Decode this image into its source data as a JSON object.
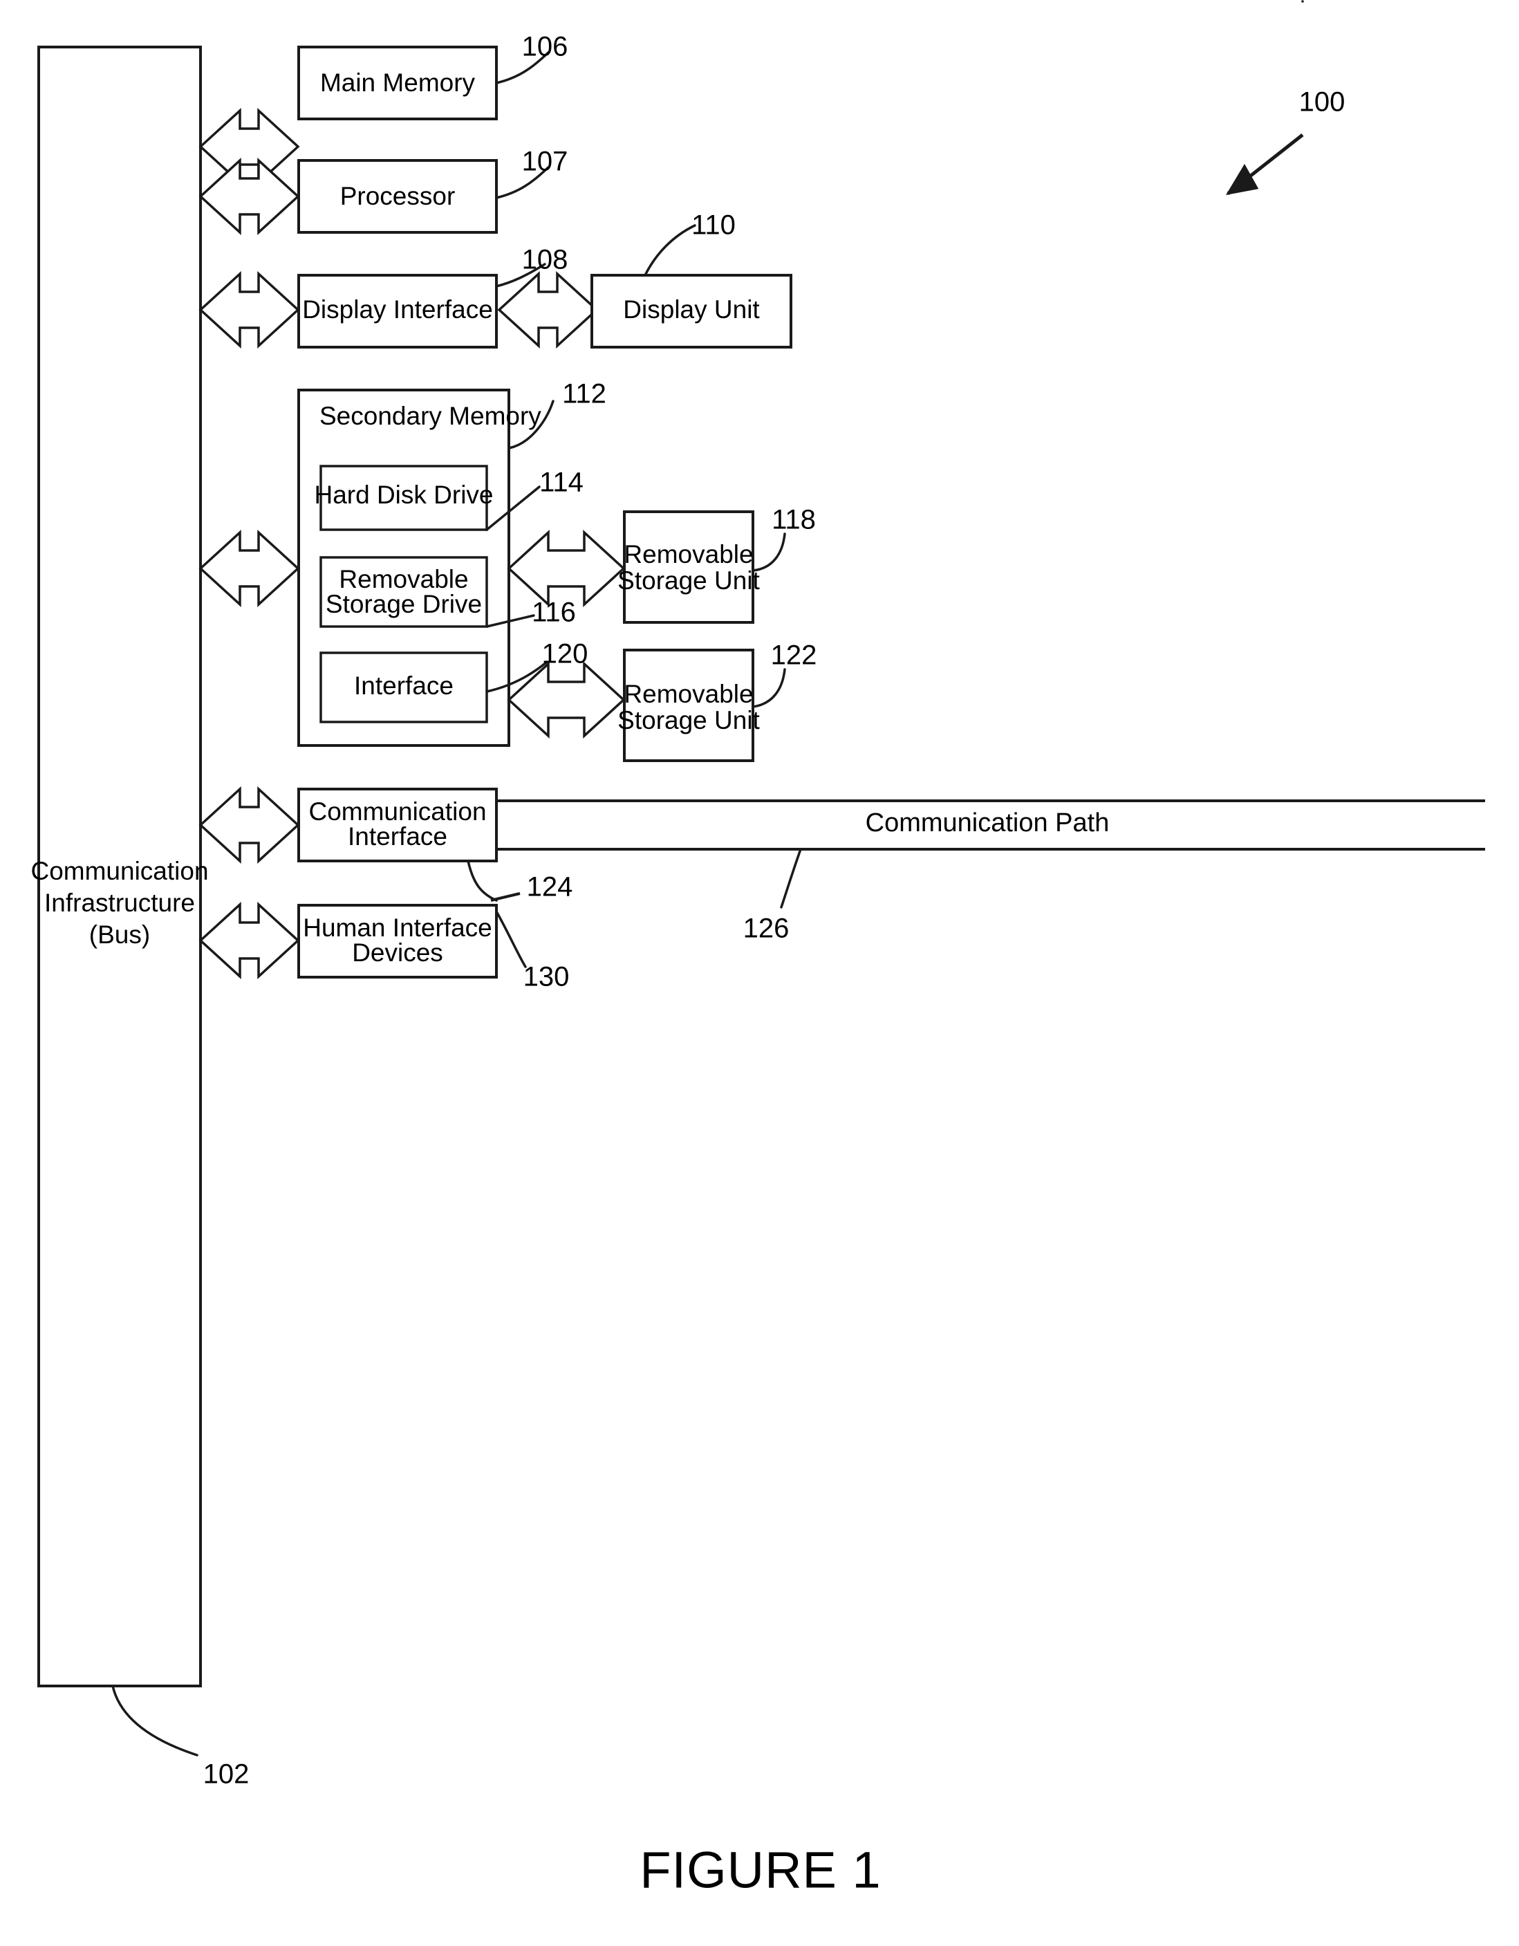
{
  "figure": {
    "caption": "FIGURE 1",
    "system_ref": "100"
  },
  "blocks": {
    "bus": {
      "label_line1": "Communication",
      "label_line2": "Infrastructure",
      "label_line3": "(Bus)",
      "ref": "102"
    },
    "main_memory": {
      "label": "Main Memory",
      "ref": "106"
    },
    "processor": {
      "label": "Processor",
      "ref": "107"
    },
    "display_interface": {
      "label": "Display Interface",
      "ref": "108"
    },
    "display_unit": {
      "label": "Display Unit",
      "ref": "110"
    },
    "secondary_memory": {
      "label": "Secondary Memory",
      "ref": "112"
    },
    "hard_disk_drive": {
      "label": "Hard Disk Drive",
      "ref": "114"
    },
    "removable_storage_drive": {
      "label_line1": "Removable",
      "label_line2": "Storage Drive",
      "ref": "116"
    },
    "removable_storage_unit_1": {
      "label_line1": "Removable",
      "label_line2": "Storage Unit",
      "ref": "118"
    },
    "interface": {
      "label": "Interface",
      "ref": "120"
    },
    "removable_storage_unit_2": {
      "label_line1": "Removable",
      "label_line2": "Storage Unit",
      "ref": "122"
    },
    "communication_interface": {
      "label_line1": "Communication",
      "label_line2": "Interface",
      "ref": "124"
    },
    "communication_path": {
      "label": "Communication Path",
      "ref": "126"
    },
    "human_interface_devices": {
      "label_line1": "Human Interface",
      "label_line2": "Devices",
      "ref": "130"
    }
  },
  "colors": {
    "line": "#1a1a1a",
    "background": "#ffffff",
    "text": "#000000"
  }
}
